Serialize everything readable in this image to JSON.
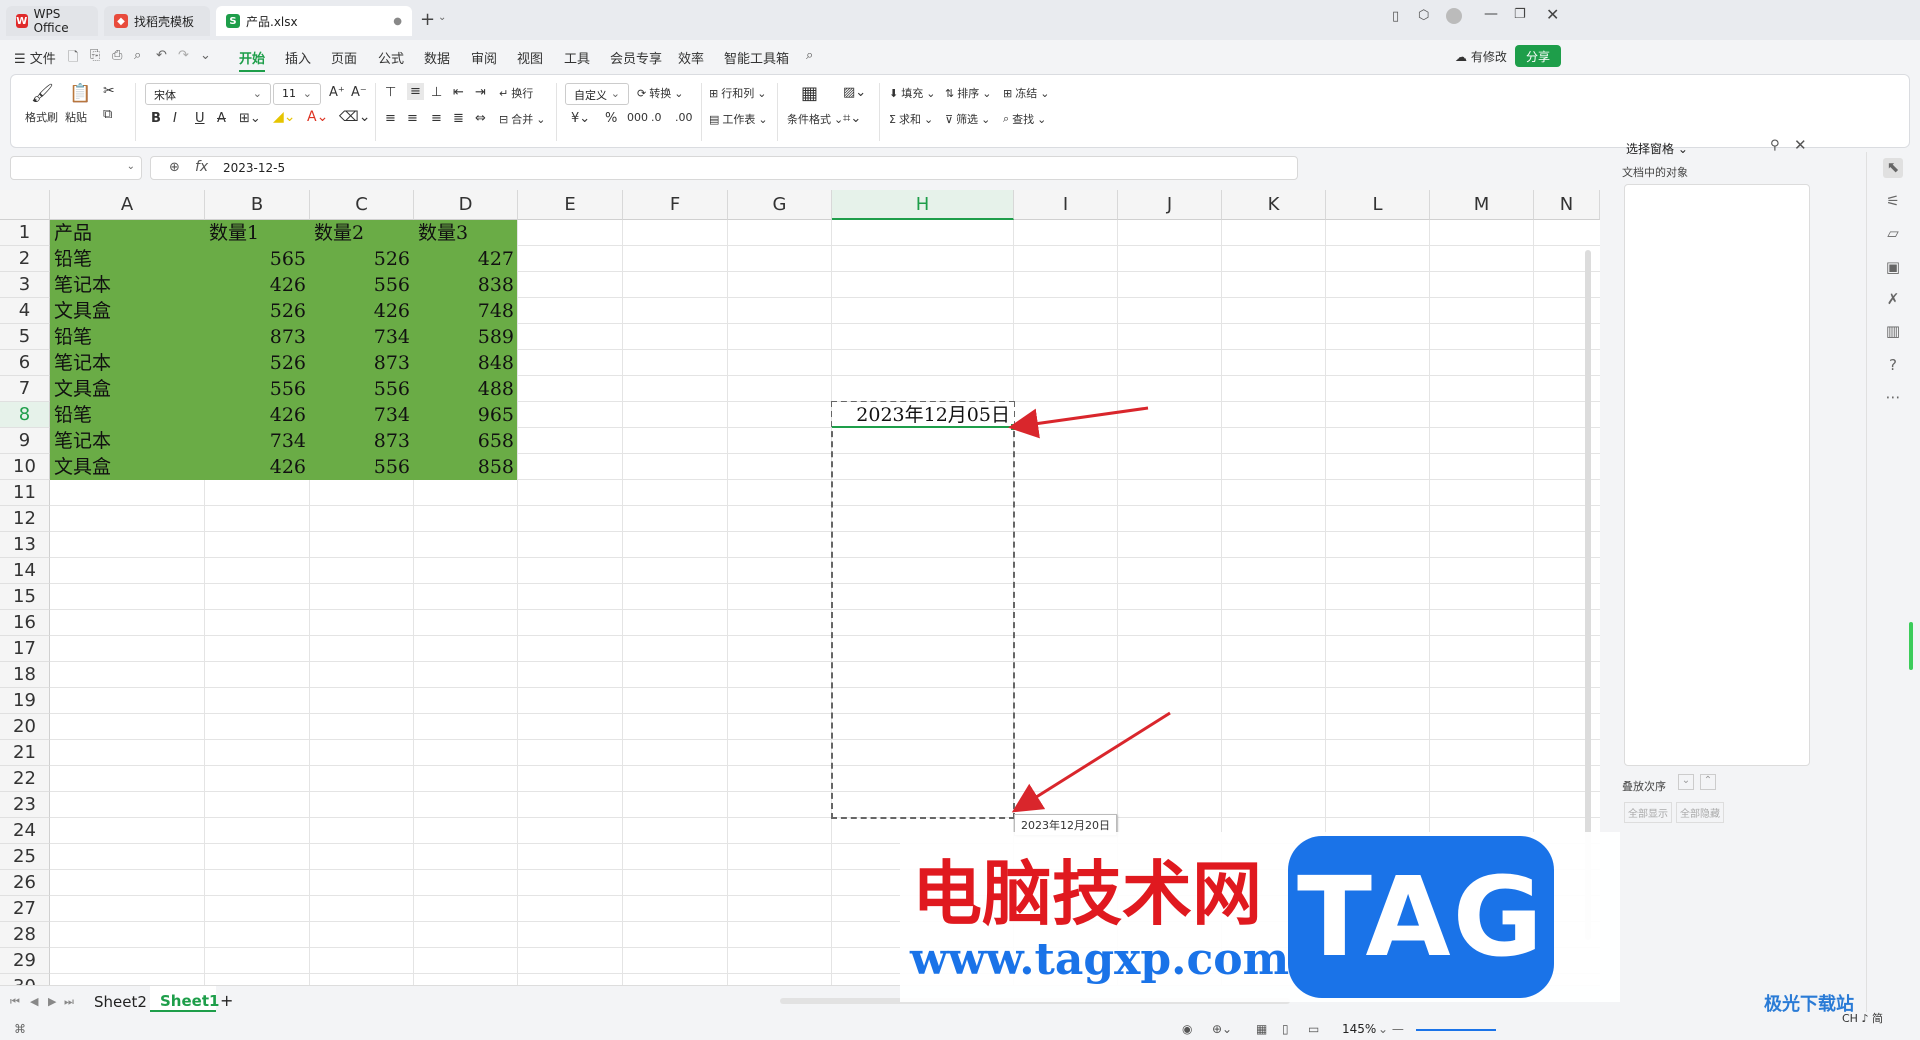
{
  "tabs": [
    {
      "label": "WPS Office",
      "icon": "wps-logo-icon"
    },
    {
      "label": "找稻壳模板",
      "icon": "docer-icon"
    },
    {
      "label": "产品.xlsx",
      "icon": "sheet-file-icon",
      "active": true
    }
  ],
  "menubar": {
    "file": "文件",
    "items": [
      "开始",
      "插入",
      "页面",
      "公式",
      "数据",
      "审阅",
      "视图",
      "工具",
      "会员专享",
      "效率",
      "智能工具箱"
    ],
    "active": "开始",
    "modified": "有修改",
    "share": "分享"
  },
  "ribbon": {
    "format_painter": "格式刷",
    "paste": "粘贴",
    "font_name": "宋体",
    "font_size": "11",
    "bold": "B",
    "italic": "I",
    "underline": "U",
    "wrap": "换行",
    "merge": "合并",
    "number_format": "自定义",
    "convert": "转换",
    "row_col": "行和列",
    "worksheet": "工作表",
    "cond_format": "条件格式",
    "fill": "填充",
    "sort": "排序",
    "freeze": "冻结",
    "sum": "求和",
    "filter": "筛选",
    "find": "查找"
  },
  "formula_bar": {
    "fx": "fx",
    "value": "2023-12-5"
  },
  "columns": [
    "A",
    "B",
    "C",
    "D",
    "E",
    "F",
    "G",
    "H",
    "I",
    "J",
    "K",
    "L",
    "M",
    "N"
  ],
  "rows": [
    "1",
    "2",
    "3",
    "4",
    "5",
    "6",
    "7",
    "8",
    "9",
    "10",
    "11",
    "12",
    "13",
    "14",
    "15",
    "16",
    "17",
    "18",
    "19",
    "20",
    "21",
    "22",
    "23",
    "24",
    "25",
    "26",
    "27",
    "28",
    "29",
    "30"
  ],
  "table": {
    "headers": [
      "产品",
      "数量1",
      "数量2",
      "数量3"
    ],
    "rows": [
      [
        "铅笔",
        "565",
        "526",
        "427"
      ],
      [
        "笔记本",
        "426",
        "556",
        "838"
      ],
      [
        "文具盒",
        "526",
        "426",
        "748"
      ],
      [
        "铅笔",
        "873",
        "734",
        "589"
      ],
      [
        "笔记本",
        "526",
        "873",
        "848"
      ],
      [
        "文具盒",
        "556",
        "556",
        "488"
      ],
      [
        "铅笔",
        "426",
        "734",
        "965"
      ],
      [
        "笔记本",
        "734",
        "873",
        "658"
      ],
      [
        "文具盒",
        "426",
        "556",
        "858"
      ]
    ],
    "fill_color": "#6aac46"
  },
  "active_cell": {
    "value": "2023年12月05日"
  },
  "fill_tooltip": "2023年12月20日",
  "sheets": {
    "tabs": [
      "Sheet2",
      "Sheet1"
    ],
    "active": "Sheet1",
    "add": "+"
  },
  "selection_pane": {
    "title": "选择窗格",
    "subtitle": "文档中的对象",
    "order_label": "叠放次序",
    "show_all": "全部显示",
    "hide_all": "全部隐藏"
  },
  "status": {
    "zoom": "145%"
  },
  "watermark": {
    "title": "电脑技术网",
    "url": "www.tagxp.com",
    "badge": "TAG",
    "corner": "极光下载站",
    "ime": "CH ♪ 简"
  },
  "colors": {
    "accent_green": "#1e9e4a",
    "fill_green": "#6aac46",
    "arrow_red": "#d9262c",
    "watermark_red": "#e0191f",
    "watermark_blue": "#1a73e8"
  }
}
